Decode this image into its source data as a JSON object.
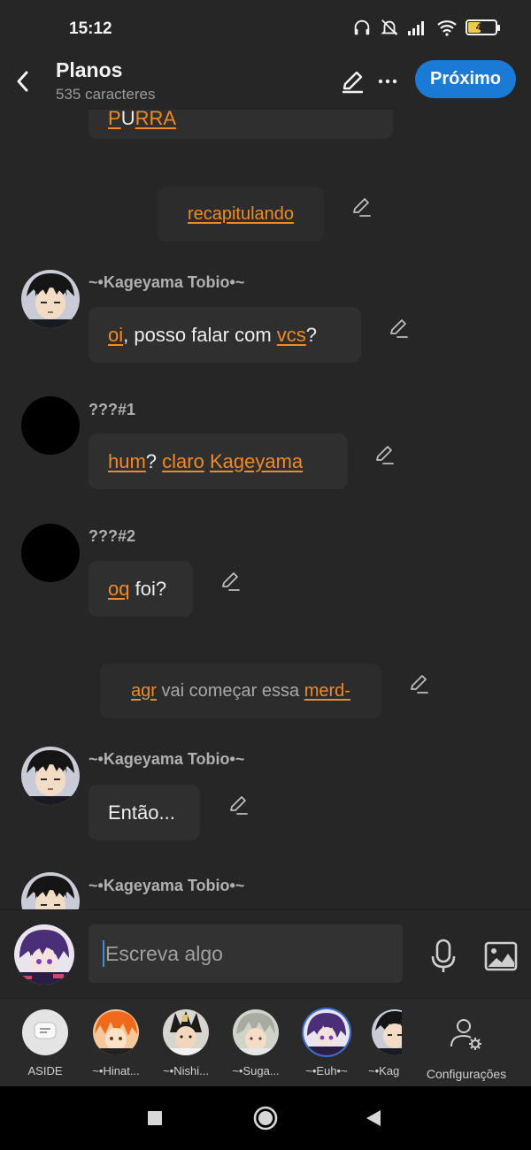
{
  "status": {
    "time": "15:12",
    "battery": "47",
    "battery_fraction": 0.47
  },
  "header": {
    "title": "Planos",
    "subtitle": "535 caracteres",
    "next_label": "Próximo"
  },
  "chat": {
    "top_fragment": {
      "p1": "P",
      "p2": "U",
      "p3": "RRA"
    },
    "narration1": "recapitulando",
    "msg1": {
      "name": "~•Kageyama Tobio•~",
      "w1": "oi",
      "t1": ", posso falar com ",
      "w2": "vcs",
      "t2": "?"
    },
    "msg2": {
      "name": "???#1",
      "w1": "hum",
      "t1": "? ",
      "w2": "claro",
      "t2": " ",
      "w3": "Kageyama"
    },
    "msg3": {
      "name": "???#2",
      "w1": "oq",
      "t1": " foi?"
    },
    "narration2": {
      "w1": "agr",
      "t1": " vai começar essa ",
      "w2": "merd-"
    },
    "msg4": {
      "name": "~•Kageyama Tobio•~",
      "text": "Então..."
    },
    "msg5": {
      "name": "~•Kageyama Tobio•~"
    }
  },
  "composer": {
    "placeholder_first": "E",
    "placeholder_rest": "screva algo"
  },
  "characters": [
    {
      "label": "ASIDE"
    },
    {
      "label": "~•Hinat..."
    },
    {
      "label": "~•Nishi..."
    },
    {
      "label": "~•Suga..."
    },
    {
      "label": "~•Euh•~"
    },
    {
      "label": "~•Kag"
    }
  ],
  "settings_label": "Configurações",
  "colors": {
    "accent": "#1a7ad6",
    "highlight": "#f08a24",
    "background": "#262626"
  }
}
